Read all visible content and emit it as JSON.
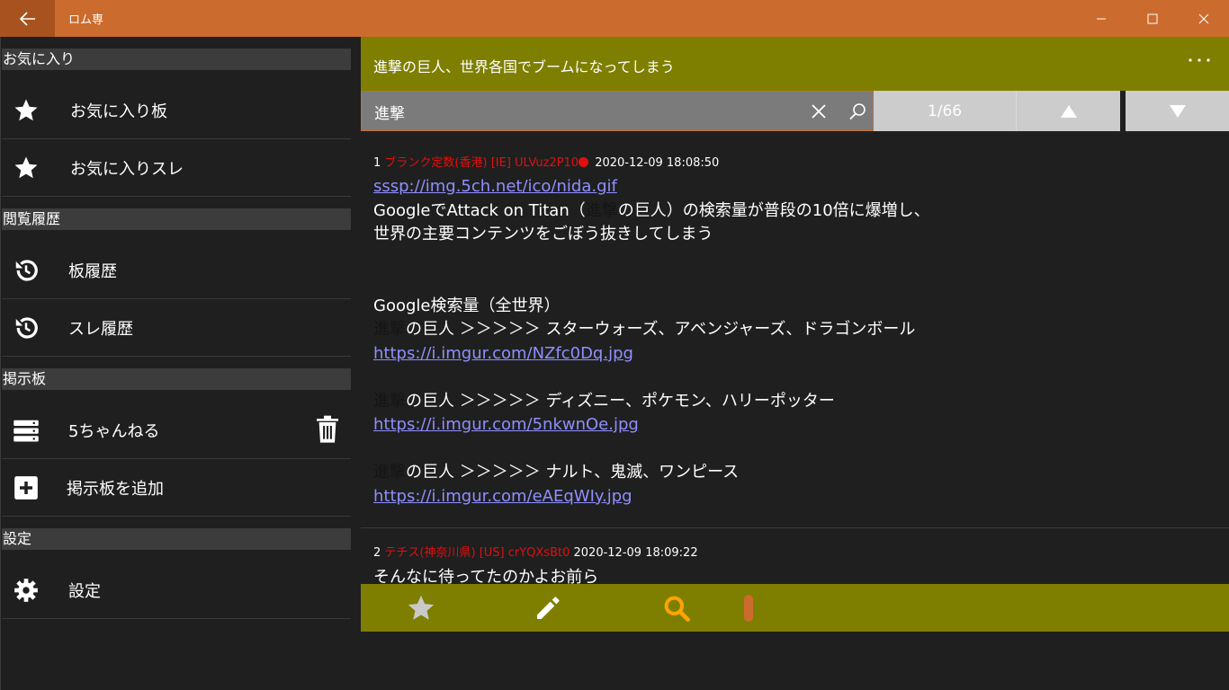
{
  "app": {
    "title": "ロム専"
  },
  "sidebar": {
    "sections": [
      {
        "header": "お気に入り",
        "items": [
          {
            "label": "お気に入り板",
            "icon": "star-icon"
          },
          {
            "label": "お気に入りスレ",
            "icon": "star-icon"
          }
        ]
      },
      {
        "header": "閲覧履歴",
        "items": [
          {
            "label": "板履歴",
            "icon": "history-icon"
          },
          {
            "label": "スレ履歴",
            "icon": "history-icon"
          }
        ]
      },
      {
        "header": "掲示板",
        "items": [
          {
            "label": "5ちゃんねる",
            "icon": "server-icon"
          },
          {
            "label": "掲示板を追加",
            "icon": "add-box-icon"
          }
        ]
      },
      {
        "header": "設定",
        "items": [
          {
            "label": "設定",
            "icon": "gear-icon"
          }
        ]
      }
    ]
  },
  "thread": {
    "title": "進撃の巨人、世界各国でブームになってしまう"
  },
  "search": {
    "query": "進撃",
    "counter": "1/66"
  },
  "posts": [
    {
      "num": "1",
      "name": "ブランク定数(香港) [IE] ULVuz2P10",
      "date": "2020-12-09 18:08:50",
      "link1": "sssp://img.5ch.net/ico/nida.gif",
      "line1a": "GoogleでAttack on Titan（",
      "line1hl": "進撃",
      "line1b": "の巨人）の検索量が普段の10倍に爆増し、",
      "line2": "世界の主要コンテンツをごぼう抜きしてしまう",
      "line3": "Google検索量（全世界）",
      "hl": "進撃",
      "row1": "の巨人 ＞＞＞＞＞ スターウォーズ、アベンジャーズ、ドラゴンボール",
      "url1": "https://i.imgur.com/NZfc0Dq.jpg",
      "row2": "の巨人 ＞＞＞＞＞ ディズニー、ポケモン、ハリーポッター",
      "url2": "https://i.imgur.com/5nkwnOe.jpg",
      "row3": "の巨人 ＞＞＞＞＞ ナルト、鬼滅、ワンピース",
      "url3": "https://i.imgur.com/eAEqWIy.jpg"
    },
    {
      "num": "2",
      "name": "テチス(神奈川県) [US] crYQXsBt0",
      "date": "2020-12-09 18:09:22",
      "body": "そんなに待ってたのかよお前ら"
    }
  ],
  "colors": {
    "accent": "#cb6b2d",
    "bar": "#7e7f00",
    "name": "#e01010",
    "link": "#8f8fff"
  }
}
